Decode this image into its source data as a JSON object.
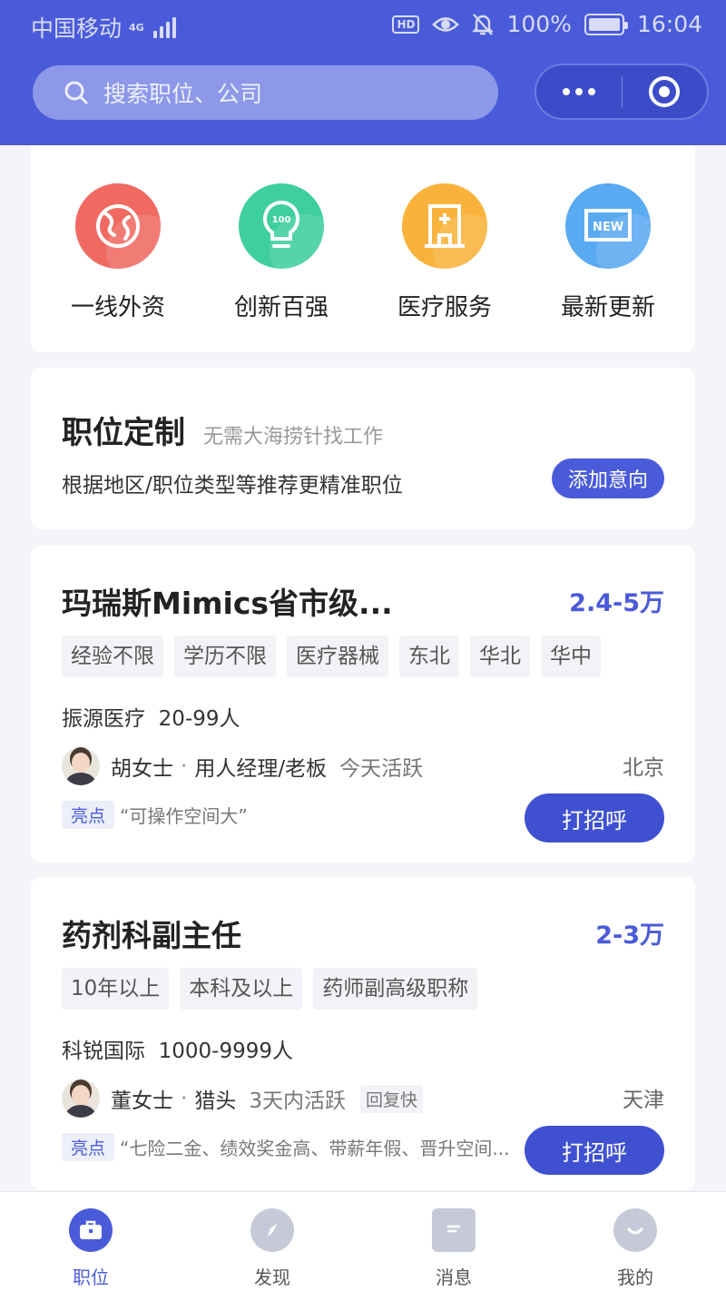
{
  "status_bar": {
    "carrier": "中国移动",
    "network": "4G",
    "hd": "HD",
    "battery": "100%",
    "battery_level": 1.0,
    "time": "16:04"
  },
  "header": {
    "search_placeholder": "搜索职位、公司",
    "accent_color": "#4a5bd9"
  },
  "categories": [
    {
      "label": "一线外资",
      "icon": "globe-icon",
      "color": "#f06a62"
    },
    {
      "label": "创新百强",
      "icon": "lightbulb-icon",
      "color": "#3fcf9e"
    },
    {
      "label": "医疗服务",
      "icon": "hospital-icon",
      "color": "#f9b33c"
    },
    {
      "label": "最新更新",
      "icon": "new-badge-icon",
      "color": "#5aaaf2"
    }
  ],
  "custom_jobs": {
    "title": "职位定制",
    "subtitle": "无需大海捞针找工作",
    "description": "根据地区/职位类型等推荐更精准职位",
    "button": "添加意向"
  },
  "jobs": [
    {
      "title": "玛瑞斯Mimics省市级...",
      "salary": "2.4-5万",
      "tags": [
        "经验不限",
        "学历不限",
        "医疗器械",
        "东北",
        "华北",
        "华中"
      ],
      "company": "振源医疗",
      "company_size": "20-99人",
      "recruiter_name": "胡女士",
      "recruiter_role": "用人经理/老板",
      "active": "今天活跃",
      "city": "北京",
      "highlight_label": "亮点",
      "highlight": "“可操作空间大”",
      "greet_button": "打招呼"
    },
    {
      "title": "药剂科副主任",
      "salary": "2-3万",
      "tags": [
        "10年以上",
        "本科及以上",
        "药师副高级职称"
      ],
      "company": "科锐国际",
      "company_size": "1000-9999人",
      "recruiter_name": "董女士",
      "recruiter_role": "猎头",
      "active": "3天内活跃",
      "reply_badge": "回复快",
      "city": "天津",
      "highlight_label": "亮点",
      "highlight": "“七险二金、绩效奖金高、带薪年假、晋升空间...",
      "greet_button": "打招呼"
    }
  ],
  "bottom_nav": [
    {
      "label": "职位",
      "icon": "briefcase-icon",
      "active": true
    },
    {
      "label": "发现",
      "icon": "compass-icon",
      "active": false
    },
    {
      "label": "消息",
      "icon": "message-icon",
      "active": false
    },
    {
      "label": "我的",
      "icon": "profile-icon",
      "active": false
    }
  ]
}
